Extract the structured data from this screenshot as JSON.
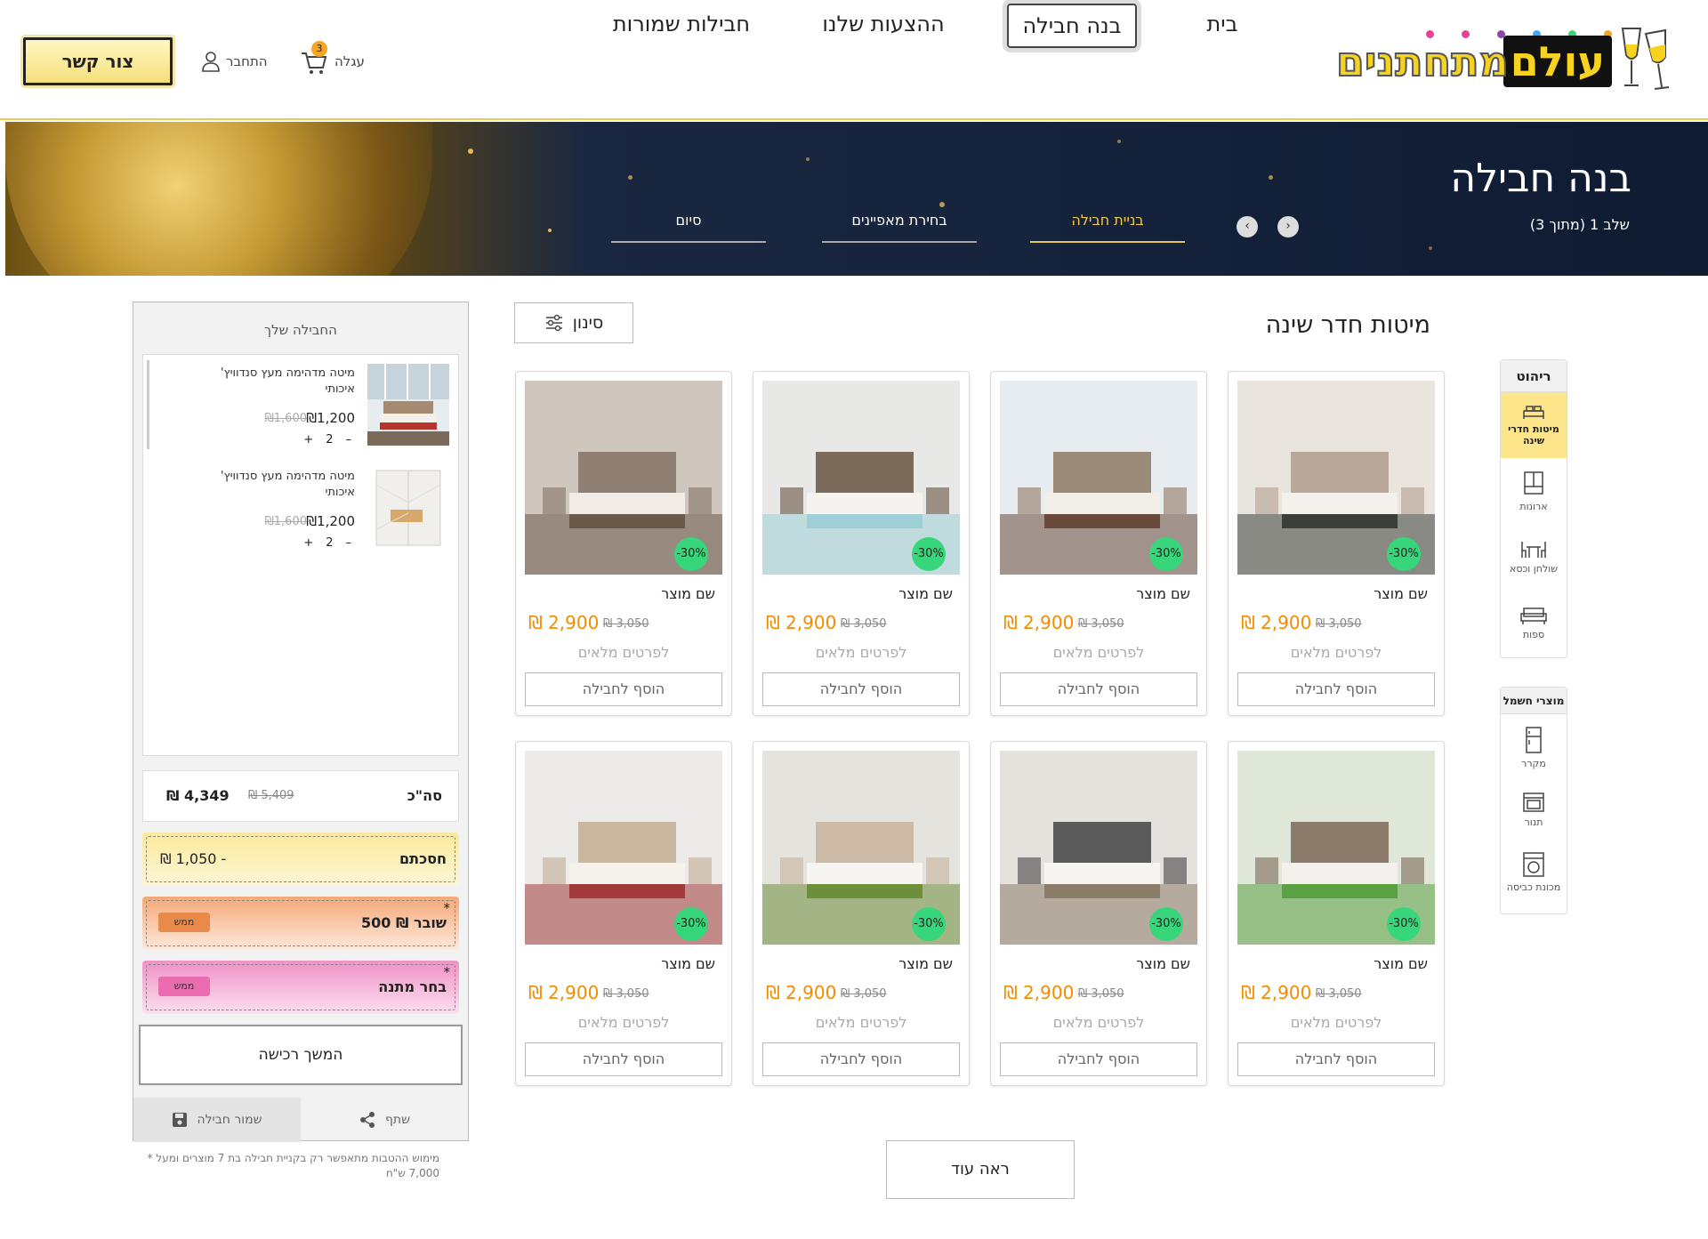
{
  "header": {
    "logo_word1": "עולם",
    "logo_word2": "מתחתנים",
    "nav": [
      "בית",
      "בנה חבילה",
      "ההצעות שלנו",
      "חבילות שמורות"
    ],
    "contact_label": "צור קשר",
    "login_label": "התחבר",
    "cart_label": "עגלה",
    "cart_count": "3"
  },
  "hero": {
    "title": "בנה חבילה",
    "step_text": "שלב 1 (מתוך 3)",
    "steps": [
      "בניית חבילה",
      "בחירת מאפיינים",
      "סיום"
    ]
  },
  "categories": {
    "furniture_title": "ריהוט",
    "furniture": [
      "מיטות חדרי שינה",
      "ארונות",
      "שולחן וכסא",
      "ספות"
    ],
    "appliances_title": "מוצרי חשמל",
    "appliances": [
      "מקרר",
      "תנור",
      "מכונת כביסה"
    ]
  },
  "products": {
    "section_title": "מיטות חדר שינה",
    "filter_label": "סינון",
    "items": [
      {
        "name": "שם מוצר",
        "price": "₪ 2,900",
        "old_price": "₪ 3,050",
        "discount": "-30%",
        "details": "לפרטים מלאים",
        "add": "הוסף לחבילה"
      },
      {
        "name": "שם מוצר",
        "price": "₪ 2,900",
        "old_price": "₪ 3,050",
        "discount": "-30%",
        "details": "לפרטים מלאים",
        "add": "הוסף לחבילה"
      },
      {
        "name": "שם מוצר",
        "price": "₪ 2,900",
        "old_price": "₪ 3,050",
        "discount": "-30%",
        "details": "לפרטים מלאים",
        "add": "הוסף לחבילה"
      },
      {
        "name": "שם מוצר",
        "price": "₪ 2,900",
        "old_price": "₪ 3,050",
        "discount": "-30%",
        "details": "לפרטים מלאים",
        "add": "הוסף לחבילה"
      },
      {
        "name": "שם מוצר",
        "price": "₪ 2,900",
        "old_price": "₪ 3,050",
        "discount": "-30%",
        "details": "לפרטים מלאים",
        "add": "הוסף לחבילה"
      },
      {
        "name": "שם מוצר",
        "price": "₪ 2,900",
        "old_price": "₪ 3,050",
        "discount": "-30%",
        "details": "לפרטים מלאים",
        "add": "הוסף לחבילה"
      },
      {
        "name": "שם מוצר",
        "price": "₪ 2,900",
        "old_price": "₪ 3,050",
        "discount": "-30%",
        "details": "לפרטים מלאים",
        "add": "הוסף לחבילה"
      },
      {
        "name": "שם מוצר",
        "price": "₪ 2,900",
        "old_price": "₪ 3,050",
        "discount": "-30%",
        "details": "לפרטים מלאים",
        "add": "הוסף לחבילה"
      }
    ],
    "more_label": "ראה עוד"
  },
  "package": {
    "title": "החבילה שלך",
    "items": [
      {
        "name": "מיטה מדהימה מעץ סנדוויץ' איכותי",
        "price": "₪1,200",
        "old_price": "₪1,600",
        "qty": "2"
      },
      {
        "name": "מיטה מדהימה מעץ סנדוויץ' איכותי",
        "price": "₪1,200",
        "old_price": "₪1,600",
        "qty": "2"
      }
    ],
    "total_label": "סה\"כ",
    "total_value": "₪ 4,349",
    "total_old": "₪ 5,409",
    "savings_label": "חסכתם",
    "savings_value": "₪ 1,050 -",
    "voucher_label": "500 ₪  שובר",
    "voucher_tag": "ממש",
    "gift_label": "בחר מתנה",
    "gift_tag": "ממש",
    "checkout_label": "המשך רכישה",
    "share_label": "שתף",
    "save_label": "שמור חבילה",
    "footnote": "* מימוש ההטבות מתאפשר רק בקניית חבילה בת 7 מוצרים ומעל 7,000 ש\"ח"
  },
  "colors": {
    "accent": "#f2c94c",
    "price": "#f28c00",
    "discount": "#37d67a",
    "savings_bg": "#fbe99a",
    "voucher_bg": "#f5a877",
    "gift_bg": "#f091c6"
  }
}
